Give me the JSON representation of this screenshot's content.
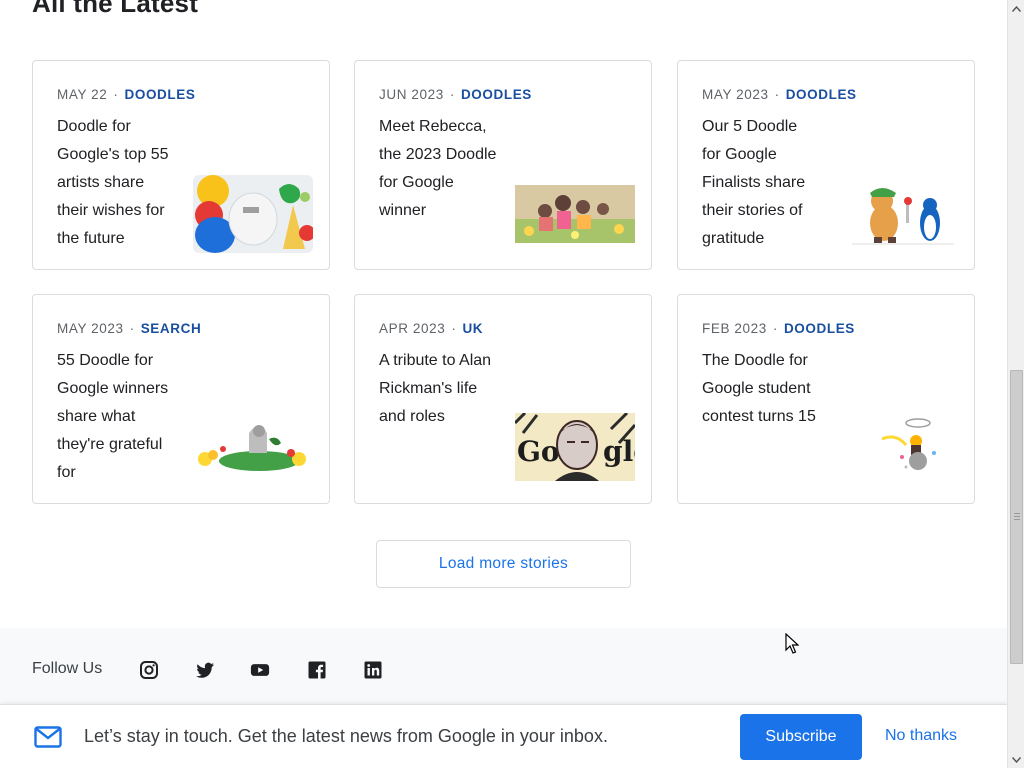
{
  "section": {
    "title": "All the Latest"
  },
  "stories": [
    {
      "date": "MAY 22",
      "tag": "DOODLES",
      "headline": "Doodle for Google's top 55 artists share their wishes for the future",
      "thumb": "doodle-artists"
    },
    {
      "date": "JUN 2023",
      "tag": "DOODLES",
      "headline": "Meet Rebecca, the 2023 Doodle for Google winner",
      "thumb": "doodle-winner"
    },
    {
      "date": "MAY 2023",
      "tag": "DOODLES",
      "headline": "Our 5 Doodle for Google Finalists share their stories of gratitude",
      "thumb": "doodle-finalists"
    },
    {
      "date": "MAY 2023",
      "tag": "SEARCH",
      "headline": "55 Doodle for Google winners share what they're grateful for",
      "thumb": "doodle-grateful"
    },
    {
      "date": "APR 2023",
      "tag": "UK",
      "headline": "A tribute to Alan Rickman's life and roles",
      "thumb": "doodle-rickman"
    },
    {
      "date": "FEB 2023",
      "tag": "DOODLES",
      "headline": "The Doodle for Google student contest turns 15",
      "thumb": "doodle-student"
    }
  ],
  "load_more": {
    "label": "Load more stories"
  },
  "footer": {
    "follow_label": "Follow Us",
    "social": [
      "instagram-icon",
      "twitter-icon",
      "youtube-icon",
      "facebook-icon",
      "linkedin-icon"
    ]
  },
  "newsletter": {
    "text": "Let’s stay in touch. Get the latest news from Google in your inbox.",
    "subscribe_label": "Subscribe",
    "dismiss_label": "No thanks"
  },
  "colors": {
    "accent": "#1a73e8",
    "tag": "#1a4fa0",
    "border": "#dadce0",
    "footer_bg": "#f8f9fa"
  }
}
